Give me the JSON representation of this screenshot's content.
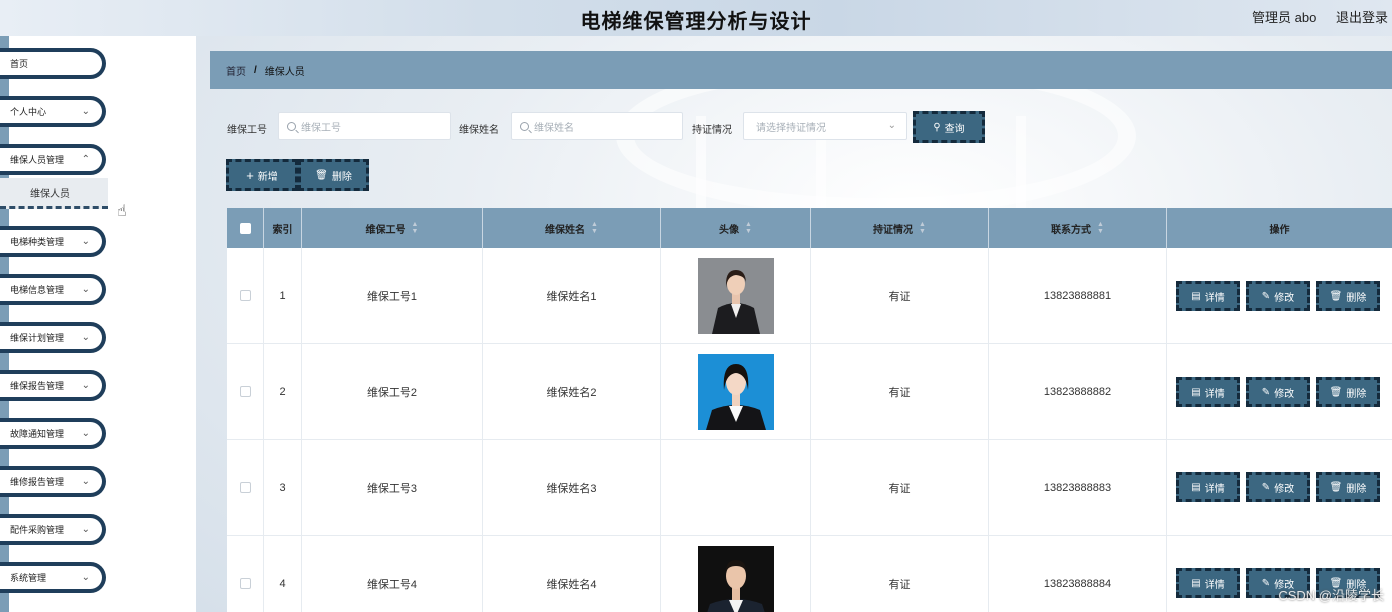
{
  "app": {
    "title": "电梯维保管理分析与设计",
    "user_label": "管理员 abo",
    "logout_label": "退出登录"
  },
  "sidebar": {
    "items": [
      {
        "label": "首页",
        "has_children": false
      },
      {
        "label": "个人中心",
        "has_children": true
      },
      {
        "label": "维保人员管理",
        "has_children": true
      },
      {
        "label": "电梯种类管理",
        "has_children": true
      },
      {
        "label": "电梯信息管理",
        "has_children": true
      },
      {
        "label": "维保计划管理",
        "has_children": true
      },
      {
        "label": "维保报告管理",
        "has_children": true
      },
      {
        "label": "故障通知管理",
        "has_children": true
      },
      {
        "label": "维修报告管理",
        "has_children": true
      },
      {
        "label": "配件采购管理",
        "has_children": true
      },
      {
        "label": "系统管理",
        "has_children": true
      }
    ],
    "active_subitem": "维保人员"
  },
  "breadcrumb": {
    "home": "首页",
    "separator": "/",
    "current": "维保人员"
  },
  "filters": {
    "worker_id_label": "维保工号",
    "worker_id_placeholder": "维保工号",
    "worker_name_label": "维保姓名",
    "worker_name_placeholder": "维保姓名",
    "cert_label": "持证情况",
    "cert_placeholder": "请选择持证情况",
    "search_button": "查询"
  },
  "toolbar": {
    "add_button": "新增",
    "delete_button": "删除"
  },
  "table": {
    "headers": {
      "index": "索引",
      "worker_id": "维保工号",
      "worker_name": "维保姓名",
      "avatar": "头像",
      "cert": "持证情况",
      "phone": "联系方式",
      "actions": "操作"
    },
    "rows": [
      {
        "index": "1",
        "worker_id": "维保工号1",
        "worker_name": "维保姓名1",
        "avatar": "female-suit-grey",
        "cert": "有证",
        "phone": "13823888881"
      },
      {
        "index": "2",
        "worker_id": "维保工号2",
        "worker_name": "维保姓名2",
        "avatar": "female-blue-bg",
        "cert": "有证",
        "phone": "13823888882"
      },
      {
        "index": "3",
        "worker_id": "维保工号3",
        "worker_name": "维保姓名3",
        "avatar": "",
        "cert": "有证",
        "phone": "13823888883"
      },
      {
        "index": "4",
        "worker_id": "维保工号4",
        "worker_name": "维保姓名4",
        "avatar": "male-suit-dark",
        "cert": "有证",
        "phone": "13823888884"
      }
    ],
    "row_actions": {
      "detail": "详情",
      "edit": "修改",
      "delete": "删除"
    }
  },
  "watermark": "CSDN @沿陵学长",
  "colors": {
    "accent": "#7b9db6",
    "button": "#3c6781",
    "border_dark": "#1f3e5b"
  }
}
